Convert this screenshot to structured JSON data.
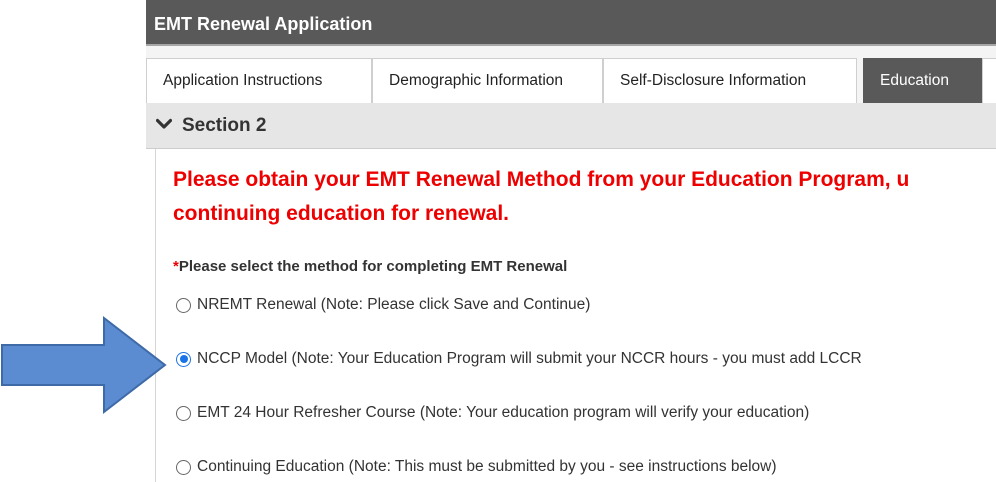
{
  "window": {
    "title": "EMT Renewal Application"
  },
  "tabs": [
    {
      "label": "Application Instructions",
      "active": false
    },
    {
      "label": "Demographic Information",
      "active": false
    },
    {
      "label": "Self-Disclosure Information",
      "active": false
    },
    {
      "label": "Education",
      "active": true
    }
  ],
  "section": {
    "title": "Section 2",
    "icon": "chevron-down-icon"
  },
  "notice": {
    "line1": "Please obtain your EMT Renewal Method from your Education Program, u",
    "line2": "continuing education for renewal."
  },
  "question": {
    "required_marker": "*",
    "label": "Please select the method for completing EMT Renewal"
  },
  "options": [
    {
      "label": "NREMT Renewal (Note: Please click Save and Continue)",
      "selected": false
    },
    {
      "label": "NCCP Model (Note: Your Education Program will submit your NCCR hours - you must add LCCR",
      "selected": true
    },
    {
      "label": "EMT 24 Hour Refresher Course (Note: Your education program will verify your education)",
      "selected": false
    },
    {
      "label": "Continuing Education (Note: This must be submitted by you - see instructions below)",
      "selected": false
    }
  ],
  "annotation": {
    "icon": "arrow-right-icon",
    "color": "#5b8bd0"
  },
  "colors": {
    "titlebar": "#595959",
    "notice": "#ee0000",
    "radio_selected": "#1a73e8"
  }
}
